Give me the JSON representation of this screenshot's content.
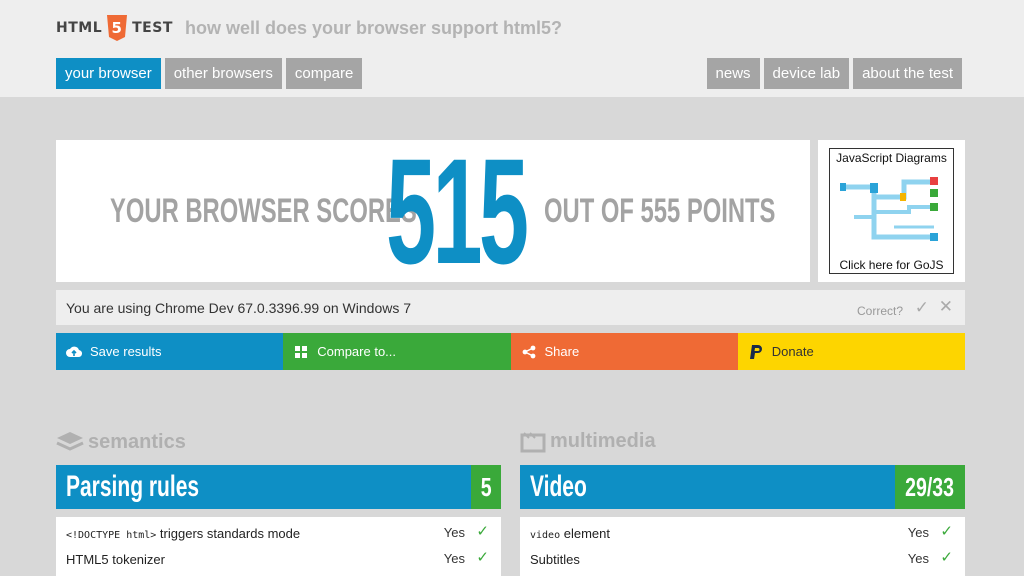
{
  "logo": {
    "left": "HTML",
    "number": "5",
    "right": "TEST"
  },
  "tagline": "how well does your browser support html5?",
  "nav_left": [
    "your browser",
    "other browsers",
    "compare"
  ],
  "nav_right": [
    "news",
    "device lab",
    "about the test"
  ],
  "score": {
    "prefix": "YOUR BROWSER SCORES",
    "value": "515",
    "suffix": "OUT OF 555 POINTS"
  },
  "ad": {
    "title": "JavaScript Diagrams",
    "footer": "Click here for GoJS"
  },
  "browser_info": {
    "text": "You are using Chrome Dev 67.0.3396.99 on Windows 7",
    "correct_label": "Correct?",
    "check": "✓",
    "close": "✕"
  },
  "actions": {
    "save": "Save results",
    "compare": "Compare to...",
    "share": "Share",
    "donate": "Donate"
  },
  "sections": {
    "semantics": {
      "title": "semantics",
      "category": "Parsing rules",
      "score": "5",
      "rows": [
        {
          "code": "<!DOCTYPE html>",
          "label": " triggers standards mode",
          "result": "Yes"
        },
        {
          "code": "",
          "label": "HTML5 tokenizer",
          "result": "Yes"
        }
      ]
    },
    "multimedia": {
      "title": "multimedia",
      "category": "Video",
      "score": "29/33",
      "rows": [
        {
          "code": "video",
          "label": " element",
          "result": "Yes"
        },
        {
          "code": "",
          "label": "Subtitles",
          "result": "Yes"
        }
      ]
    }
  },
  "colors": {
    "blue": "#0e8fc5",
    "green": "#3aa93a",
    "orange": "#ef6a35",
    "yellow": "#fdd500",
    "grey_btn": "#a5a5a5"
  }
}
